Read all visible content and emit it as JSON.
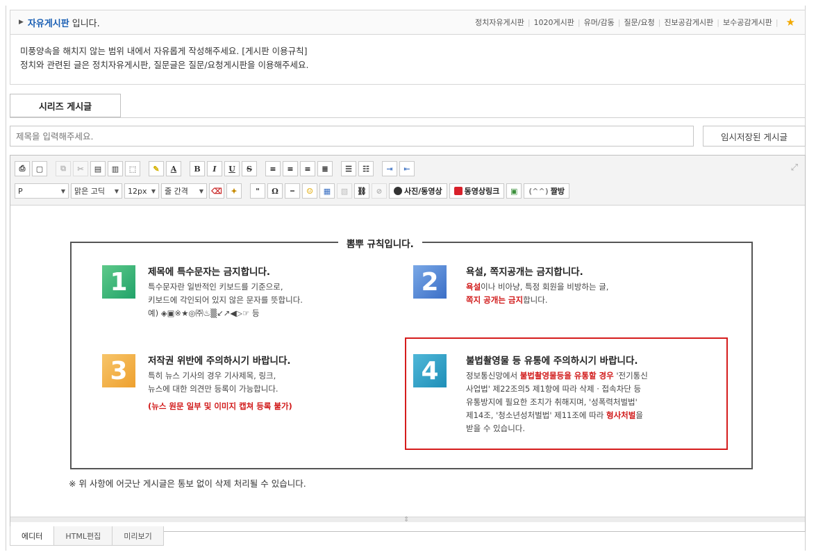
{
  "header": {
    "board_name": "자유게시판",
    "board_suffix": "입니다.",
    "links": [
      "정치자유게시판",
      "1020게시판",
      "유머/감동",
      "질문/요청",
      "진보공감게시판",
      "보수공감게시판"
    ]
  },
  "notice": {
    "line1": "미풍양속을 해치지 않는 범위 내에서 자유롭게 작성해주세요. [게시판 이용규칙]",
    "line2": "정치와 관련된 글은 정치자유게시판, 질문글은 질문/요청게시판을 이용해주세요."
  },
  "series_tab": "시리즈 게시글",
  "title_input": {
    "placeholder": "제목을 입력해주세요."
  },
  "temp_saved_button": "임시저장된 게시글",
  "toolbar": {
    "paragraph": "P",
    "font": "맑은 고딕",
    "size": "12px",
    "line_spacing": "줄 간격",
    "photo_video": "사진/동영상",
    "video_link": "동영상링크",
    "emoticon": "짤방"
  },
  "rules": {
    "title": "뽐뿌 규칙입니다.",
    "r1": {
      "num": "1",
      "head": "제목에 특수문자는 금지합니다.",
      "body1": "특수문자란 일반적인 키보드를 기준으로,",
      "body2": "키보드에 각인되어 있지 않은 문자를 뜻합니다.",
      "body3": "예) ◈▣※★◎㈜♨▒↙↗◀▷☞ 등"
    },
    "r2": {
      "num": "2",
      "head": "욕설, 쪽지공개는 금지합니다.",
      "body1_red": "욕설",
      "body1_rest": "이나 비아냥, 특정 회원을 비방하는 글,",
      "body2_red": "쪽지 공개는 금지",
      "body2_rest": "합니다."
    },
    "r3": {
      "num": "3",
      "head": "저작권 위반에 주의하시기 바랍니다.",
      "body1": "특히 뉴스 기사의 경우 기사제목, 링크,",
      "body2": "뉴스에 대한 의견만 등록이 가능합니다.",
      "body3": "(뉴스 원문 일부 및 이미지 캡쳐 등록 불가)"
    },
    "r4": {
      "num": "4",
      "head": "불법촬영물 등 유통에 주의하시기 바랍니다.",
      "body1_a": "정보통신망에서 ",
      "body1_red": "불법촬영물등을 유통할 경우",
      "body1_b": " '전기통신",
      "body2": "사업법' 제22조의5 제1항에 따라 삭제 · 접속차단 등",
      "body3": "유통방지에 필요한 조치가 취해지며, '성폭력처벌법'",
      "body4_a": "제14조, '청소년성처벌법' 제11조에 따라 ",
      "body4_red": "형사처벌",
      "body4_b": "을",
      "body5": "받을 수 있습니다."
    }
  },
  "footer_note": "※ 위 사항에 어긋난 게시글은 통보 없이 삭제 처리될 수 있습니다.",
  "mode_tabs": [
    "에디터",
    "HTML편집",
    "미리보기"
  ]
}
